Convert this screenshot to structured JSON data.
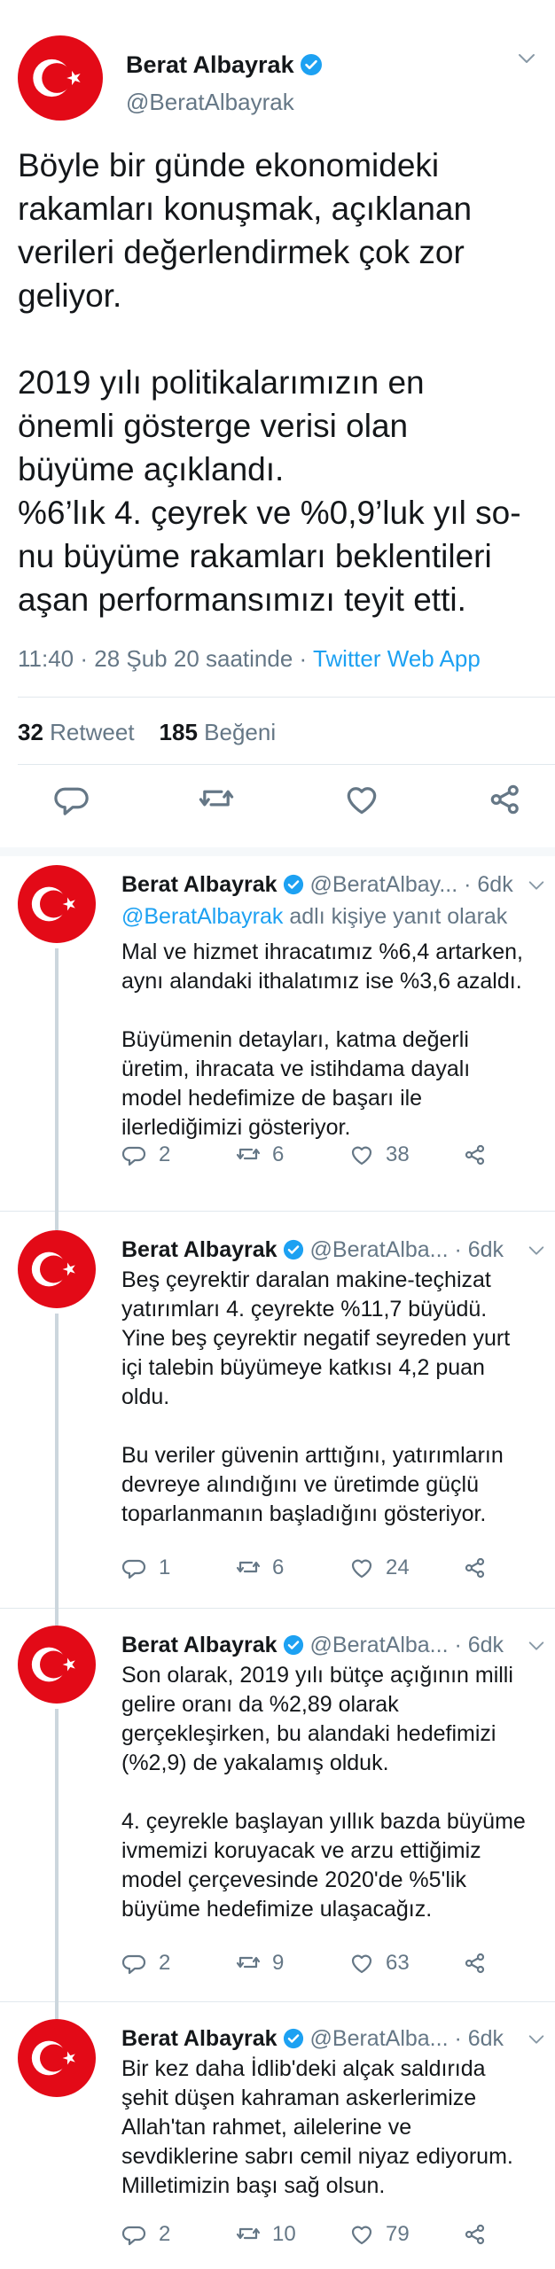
{
  "main_tweet": {
    "author_name": "Berat Albayrak",
    "handle": "@BeratAlbayrak",
    "text": "Böyle bir günde ekonomideki\nrakamları konuşmak, açıklanan\nverileri değerlendirmek çok zor\ngeliyor.\n\n2019 yılı politikalarımızın en\nönemli gösterge verisi olan\nbüyüme açıklandı.\n%6’lık 4. çeyrek ve %0,9’luk yıl so-\nnu büyüme rakamları beklentileri\naşan performansımızı teyit etti.",
    "time": "11:40 · 28 Şub 20 saatinde · ",
    "source": "Twitter Web App",
    "retweets_count": "32",
    "retweets_label": "Retweet",
    "likes_count": "185",
    "likes_label": "Beğeni"
  },
  "replies": [
    {
      "author_name": "Berat Albayrak",
      "handle_time": "@BeratAlbay... · 6dk",
      "reply_mention": "@BeratAlbayrak",
      "reply_suffix": " adlı kişiye yanıt olarak",
      "text": "Mal ve hizmet ihracatımız %6,4 artarken,\naynı alandaki ithalatımız ise %3,6 azaldı.\n\nBüyümenin detayları, katma değerli\nüretim, ihracata ve istihdama dayalı\nmodel hedefimize de başarı ile\nilerlediğimizi gösteriyor.",
      "replies": "2",
      "retweets": "6",
      "likes": "38"
    },
    {
      "author_name": "Berat Albayrak",
      "handle_time": "@BeratAlba... · 6dk",
      "text": "Beş çeyrektir daralan makine-teçhizat\nyatırımları 4. çeyrekte %11,7 büyüdü.\nYine beş çeyrektir negatif seyreden yurt\niçi talebin büyümeye katkısı 4,2 puan\noldu.\n\nBu veriler güvenin arttığını, yatırımların\ndevreye alındığını ve üretimde güçlü\ntoparlanmanın başladığını gösteriyor.",
      "replies": "1",
      "retweets": "6",
      "likes": "24"
    },
    {
      "author_name": "Berat Albayrak",
      "handle_time": "@BeratAlba... · 6dk",
      "text": "Son olarak, 2019 yılı bütçe açığının milli\ngelire oranı da %2,89 olarak\ngerçekleşirken, bu alandaki hedefimizi\n(%2,9) de yakalamış olduk.\n\n4. çeyrekle başlayan yıllık bazda büyüme\nivmemizi koruyacak ve arzu ettiğimiz\nmodel çerçevesinde 2020'de %5'lik\nbüyüme hedefimize ulaşacağız.",
      "replies": "2",
      "retweets": "9",
      "likes": "63"
    },
    {
      "author_name": "Berat Albayrak",
      "handle_time": "@BeratAlba... · 6dk",
      "text": "Bir kez daha İdlib'deki alçak saldırıda\nşehit düşen kahraman askerlerimize\nAllah'tan rahmet, ailelerine ve\nsevdiklerine sabrı cemil niyaz ediyorum.\nMilletimizin başı sağ olsun.",
      "replies": "2",
      "retweets": "10",
      "likes": "79"
    }
  ],
  "colors": {
    "flag_red": "#e30a17",
    "link_blue": "#1da1f2",
    "secondary_text": "#657786",
    "icon_gray": "#657786"
  },
  "icons": [
    "turkish-flag-avatar",
    "verified-badge-icon",
    "chevron-down-icon",
    "reply-icon",
    "retweet-icon",
    "like-icon",
    "share-icon"
  ]
}
